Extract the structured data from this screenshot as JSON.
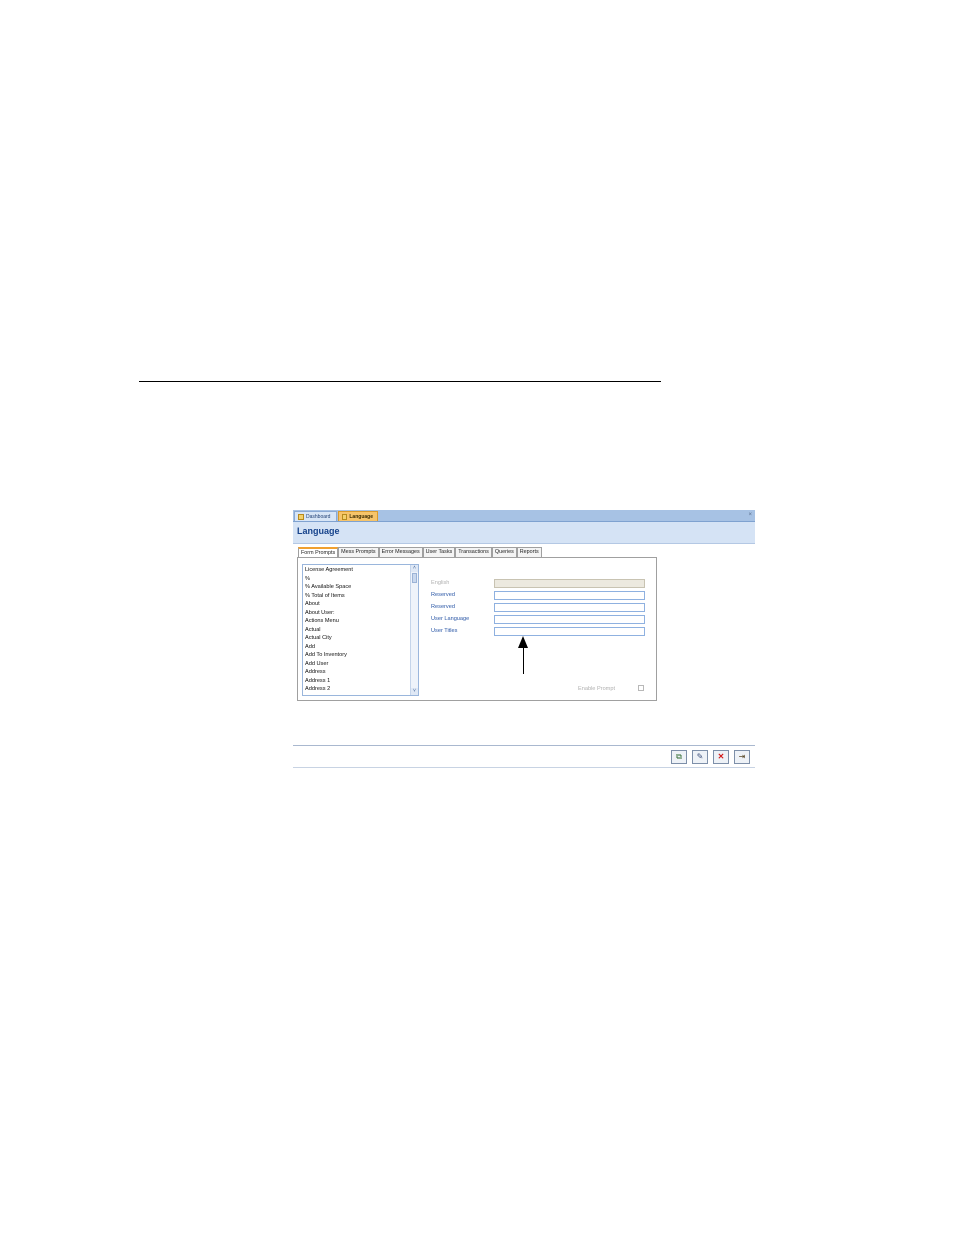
{
  "doc_tabs": [
    {
      "label": "Dashboard",
      "icon": "form-icon"
    },
    {
      "label": "Language",
      "icon": "form-icon",
      "active": true
    }
  ],
  "close_label": "×",
  "header": {
    "title": "Language"
  },
  "tabs": [
    "Form Prompts",
    "Mess Prompts",
    "Error Messages",
    "User Tasks",
    "Transactions",
    "Queries",
    "Reports"
  ],
  "list": {
    "items": [
      "License Agreement",
      "%",
      "% Available Space",
      "% Total of Items",
      "About",
      "About User:",
      "Actions Menu",
      "Actual",
      "Actual City",
      "Add",
      "Add To Inventory",
      "Add User",
      "Address",
      "Address 1",
      "Address 2"
    ],
    "scroll_up": "˄",
    "scroll_down": "˅"
  },
  "fields": [
    {
      "label": "English",
      "value": "",
      "disabled": true
    },
    {
      "label": "Reserved",
      "value": ""
    },
    {
      "label": "Reserved",
      "value": ""
    },
    {
      "label": "User Language",
      "value": ""
    },
    {
      "label": "User Titles",
      "value": ""
    }
  ],
  "enable_prompt": {
    "label": "Enable Prompt",
    "checked": false
  },
  "toolbar": {
    "buttons": [
      {
        "name": "copy-button",
        "icon": "copy-icon",
        "glyph": "⧉"
      },
      {
        "name": "edit-button",
        "icon": "edit-icon",
        "glyph": "✎"
      },
      {
        "name": "delete-button",
        "icon": "delete-icon",
        "glyph": "✕"
      },
      {
        "name": "exit-button",
        "icon": "exit-door-icon",
        "glyph": "⇥"
      }
    ]
  },
  "colors": {
    "header_bg": "#d5e3f5",
    "header_text": "#15428b",
    "active_tab": "#f6c46a",
    "label_blue": "#2b57a6"
  }
}
